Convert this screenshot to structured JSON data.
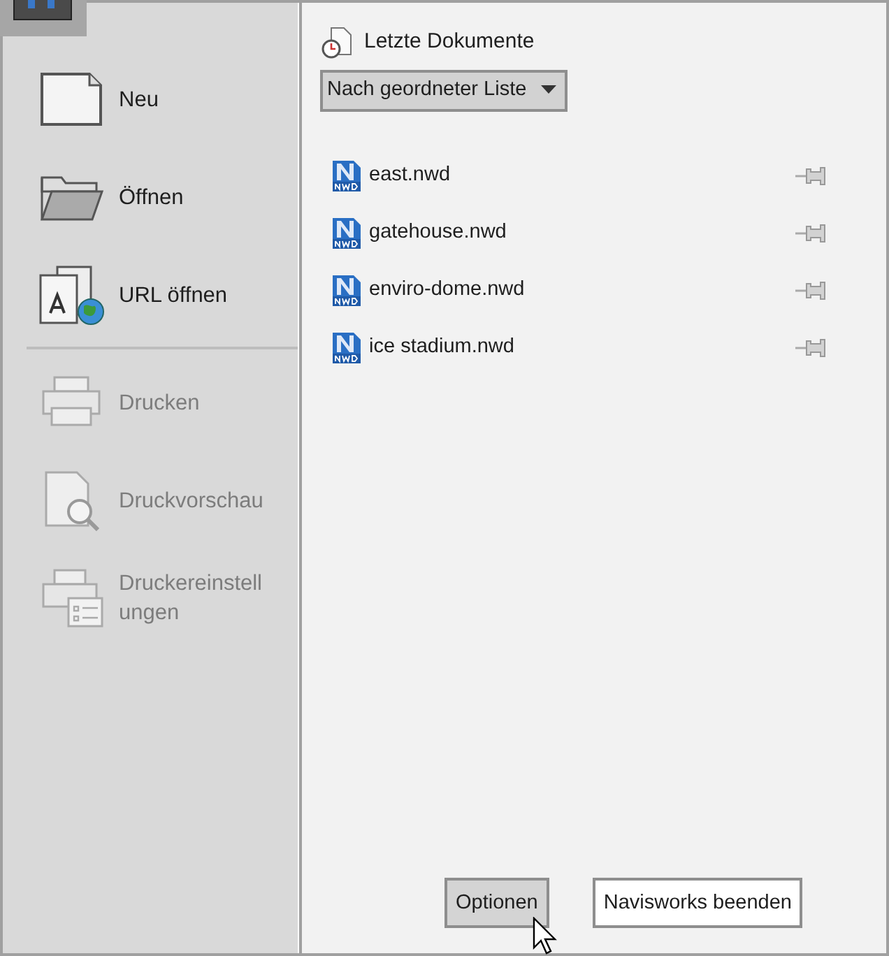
{
  "sidebar": {
    "groups": [
      [
        {
          "label": "Neu",
          "kind": "new",
          "disabled": false
        },
        {
          "label": "Öffnen",
          "kind": "open",
          "disabled": false
        },
        {
          "label": "URL öffnen",
          "kind": "url",
          "disabled": false
        }
      ],
      [
        {
          "label": "Drucken",
          "kind": "print",
          "disabled": true
        },
        {
          "label": "Druckvorschau",
          "kind": "preview",
          "disabled": true
        },
        {
          "label": "Druckereinstellungen",
          "kind": "printsetup",
          "disabled": true
        }
      ]
    ]
  },
  "recent": {
    "title": "Letzte Dokumente",
    "sort": "Nach geordneter Liste",
    "files": [
      {
        "name": "east.nwd",
        "pinned": false
      },
      {
        "name": "gatehouse.nwd",
        "pinned": false
      },
      {
        "name": "enviro-dome.nwd",
        "pinned": false
      },
      {
        "name": "ice stadium.nwd",
        "pinned": false
      }
    ]
  },
  "buttons": [
    {
      "label": "Optionen",
      "hovered": true
    },
    {
      "label": "Navisworks beenden",
      "hovered": false
    }
  ]
}
